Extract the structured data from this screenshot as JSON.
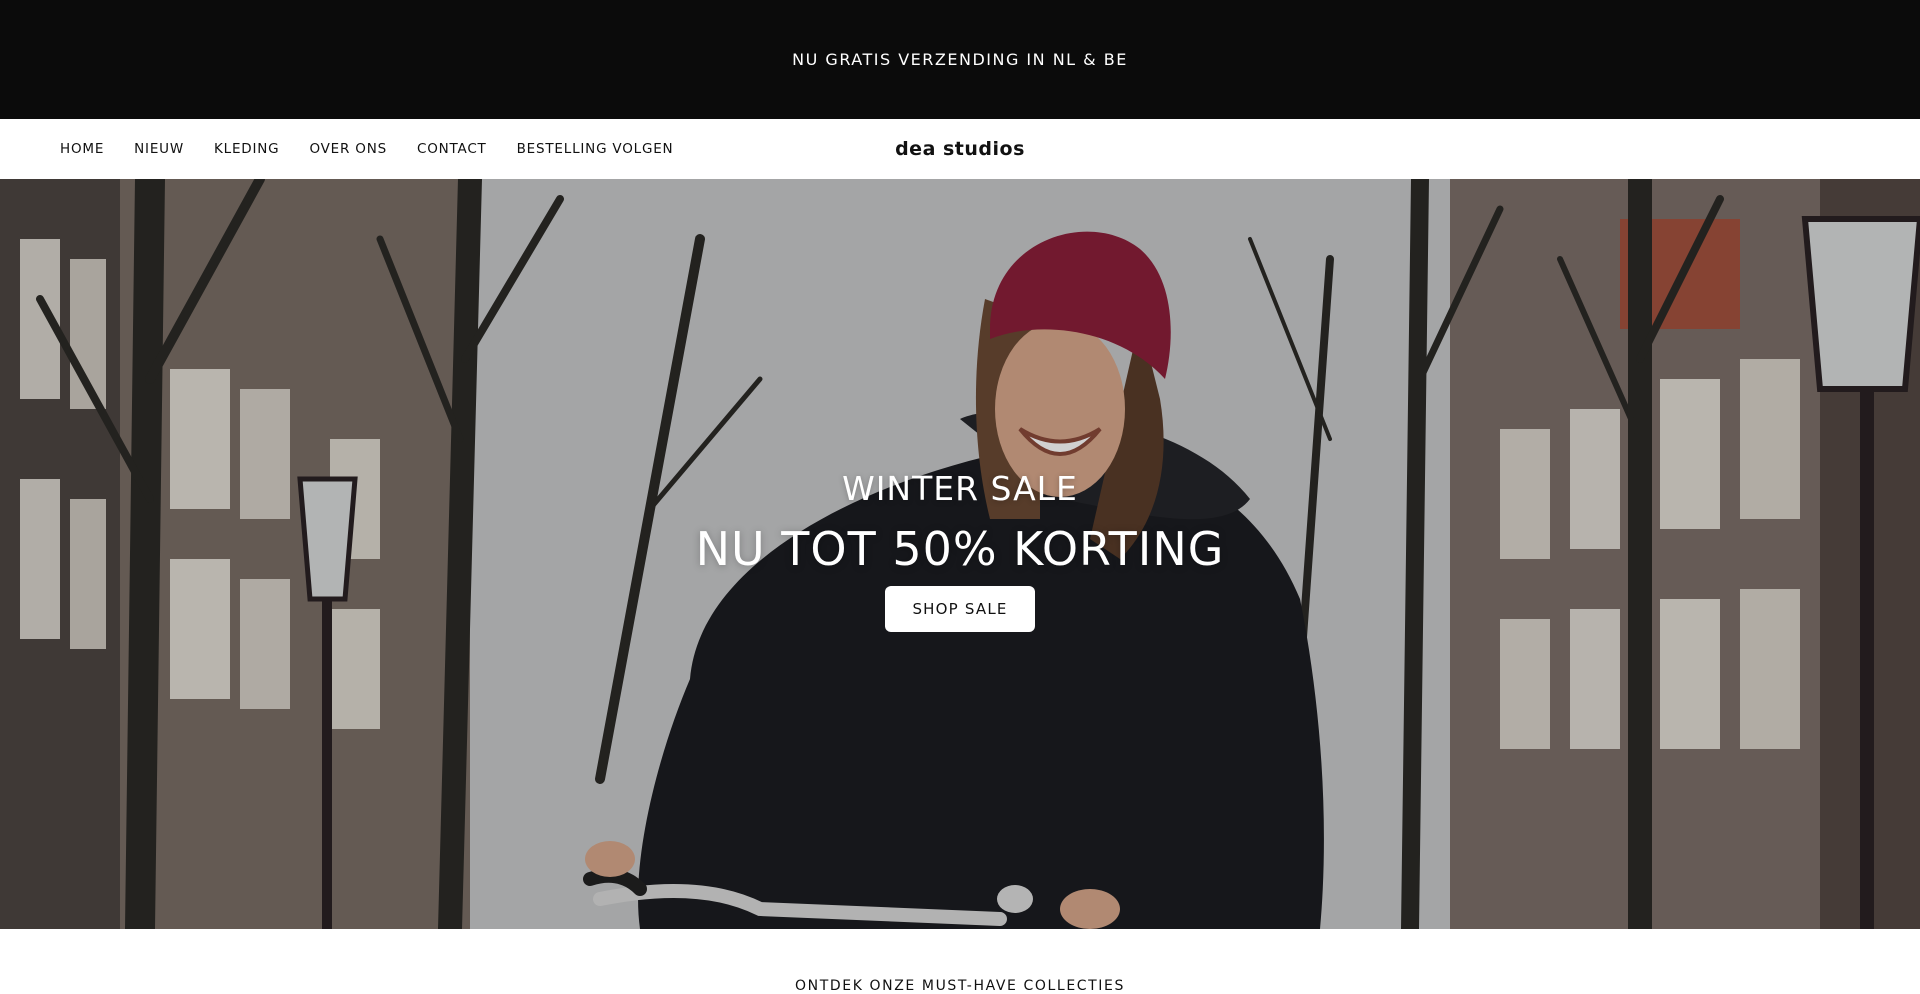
{
  "announcement": {
    "text": "NU GRATIS VERZENDING IN NL & BE"
  },
  "header": {
    "nav": [
      {
        "label": "HOME"
      },
      {
        "label": "NIEUW"
      },
      {
        "label": "KLEDING"
      },
      {
        "label": "OVER ONS"
      },
      {
        "label": "CONTACT"
      },
      {
        "label": "BESTELLING VOLGEN"
      }
    ],
    "logo": "dea studios"
  },
  "hero": {
    "kicker": "WINTER SALE",
    "title": "NU TOT 50% KORTING",
    "button_label": "SHOP SALE",
    "image_subject": "woman-in-red-beanie-on-bicycle"
  },
  "collections": {
    "heading": "ONTDEK ONZE MUST-HAVE COLLECTIES"
  },
  "colors": {
    "announcement_bg": "#0b0b0b",
    "text_dark": "#111111",
    "button_bg": "#ffffff",
    "beanie": "#8c1f3a",
    "jacket": "#1c1d21"
  }
}
